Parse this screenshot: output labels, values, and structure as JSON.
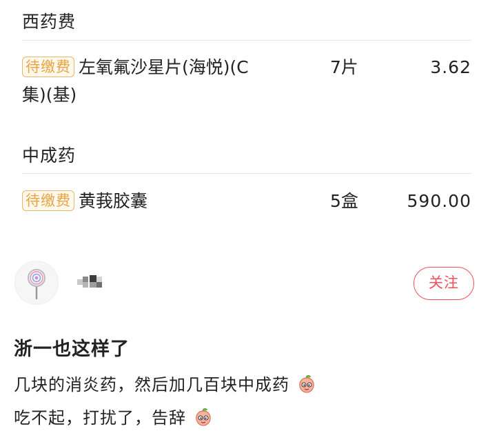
{
  "sections": [
    {
      "title": "西药费",
      "items": [
        {
          "badge": "待缴费",
          "name": "左氧氟沙星片(海悦)(C集)(基)",
          "name_line1": "左氧氟沙星片(海悦)(C",
          "name_line2": "集)(基)",
          "qty": "7片",
          "price": "3.62"
        }
      ]
    },
    {
      "title": "中成药",
      "items": [
        {
          "badge": "待缴费",
          "name": "黄莪胶囊",
          "qty": "5盒",
          "price": "590.00"
        }
      ]
    }
  ],
  "post": {
    "follow_label": "关注",
    "title": "浙一也这样了",
    "line1": "几块的消炎药，然后加几百块中成药",
    "line2": "吃不起，打扰了，告辞",
    "emoji_icon": "peach-face-icon"
  },
  "colors": {
    "badge_text": "#e6a443",
    "badge_border": "#e9b56a",
    "follow_red": "#f24d5b",
    "divider": "#e6e6e6"
  }
}
